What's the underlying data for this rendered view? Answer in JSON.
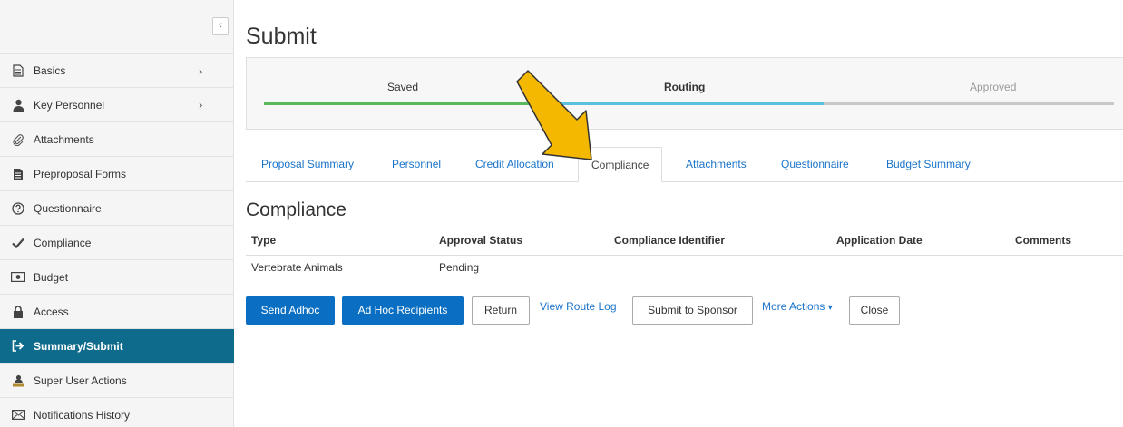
{
  "sidebar": {
    "collapse_glyph": "‹",
    "items": [
      {
        "label": "Basics",
        "icon": "document-icon",
        "chevron": "›"
      },
      {
        "label": "Key Personnel",
        "icon": "person-icon",
        "chevron": "›"
      },
      {
        "label": "Attachments",
        "icon": "paperclip-icon"
      },
      {
        "label": "Preproposal Forms",
        "icon": "forms-icon"
      },
      {
        "label": "Questionnaire",
        "icon": "question-circle-icon"
      },
      {
        "label": "Compliance",
        "icon": "checkmark-icon"
      },
      {
        "label": "Budget",
        "icon": "money-icon"
      },
      {
        "label": "Access",
        "icon": "lock-icon"
      },
      {
        "label": "Summary/Submit",
        "icon": "sign-out-icon",
        "active": true
      },
      {
        "label": "Super User Actions",
        "icon": "users-icon"
      },
      {
        "label": "Notifications History",
        "icon": "envelope-icon"
      }
    ]
  },
  "page": {
    "title": "Submit"
  },
  "progress": {
    "steps": [
      {
        "label": "Saved",
        "status": "complete",
        "color": "#5cb85c"
      },
      {
        "label": "Routing",
        "status": "current",
        "color": "#5bc0de"
      },
      {
        "label": "Approved",
        "status": "pending",
        "color": "#c8c8c8"
      }
    ]
  },
  "tabs": [
    {
      "label": "Proposal Summary"
    },
    {
      "label": "Personnel"
    },
    {
      "label": "Credit Allocation"
    },
    {
      "label": "Compliance",
      "active": true
    },
    {
      "label": "Attachments"
    },
    {
      "label": "Questionnaire"
    },
    {
      "label": "Budget Summary"
    }
  ],
  "compliance": {
    "title": "Compliance",
    "columns": [
      "Type",
      "Approval Status",
      "Compliance Identifier",
      "Application Date",
      "Comments"
    ],
    "rows": [
      [
        "Vertebrate Animals",
        "Pending",
        "",
        "",
        ""
      ]
    ]
  },
  "actions": {
    "send_adhoc": "Send Adhoc",
    "adhoc_recipients": "Ad Hoc Recipients",
    "return": "Return",
    "view_route_log": "View Route Log",
    "submit_to_sponsor": "Submit to Sponsor",
    "more_actions": "More Actions",
    "more_actions_caret": "▾",
    "close": "Close"
  },
  "colors": {
    "active_nav": "#0e6b8b",
    "primary_button": "#0a6fc2",
    "link": "#1a73c9",
    "annotation_arrow": "#f5b800"
  }
}
